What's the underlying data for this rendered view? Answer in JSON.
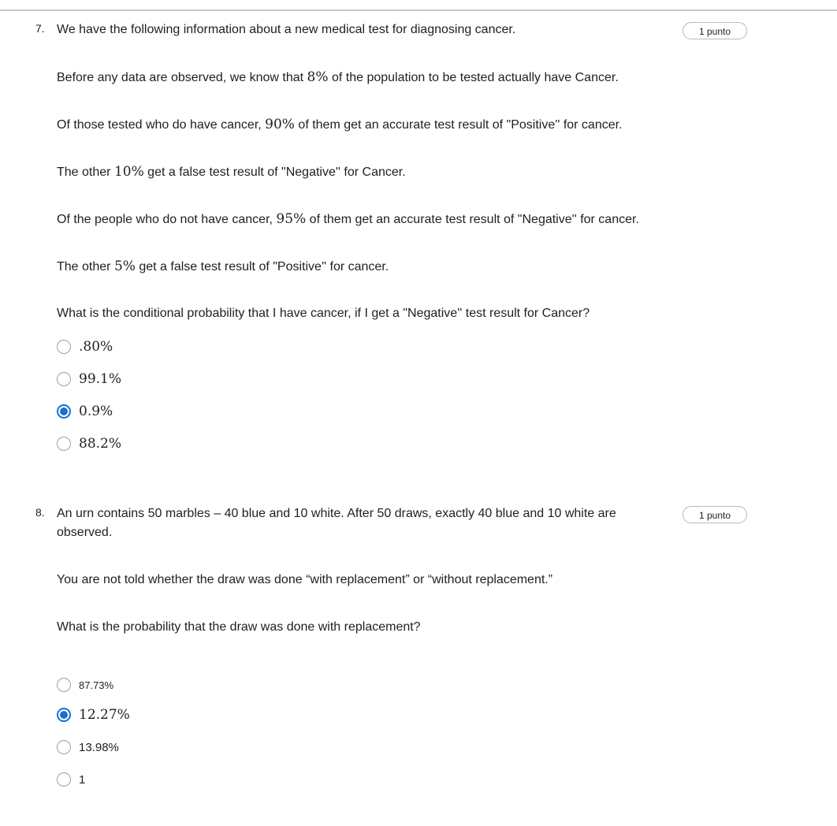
{
  "questions": [
    {
      "number": "7.",
      "points": "1 punto",
      "paragraphs": [
        {
          "pre": "We have the following information about a new medical test for diagnosing cancer.",
          "math": "",
          "post": ""
        },
        {
          "pre": "Before any data are observed, we know that ",
          "math": "8%",
          "post": " of the population to be tested actually have Cancer."
        },
        {
          "pre": "Of those tested who do have cancer, ",
          "math": "90%",
          "post": " of them get an accurate test result of \"Positive'' for cancer."
        },
        {
          "pre": "The other ",
          "math": "10%",
          "post": " get a false test result of \"Negative'' for Cancer."
        },
        {
          "pre": "Of the people who do not have cancer, ",
          "math": "95%",
          "post": " of them get an accurate test result of \"Negative'' for cancer."
        },
        {
          "pre": "The other ",
          "math": "5%",
          "post": " get a false test result of \"Positive'' for cancer."
        },
        {
          "pre": "What is the conditional probability that I have cancer, if I get a \"Negative'' test result for Cancer?",
          "math": "",
          "post": ""
        }
      ],
      "options": [
        {
          "label": ".80%",
          "selected": false
        },
        {
          "label": "99.1%",
          "selected": false
        },
        {
          "label": "0.9%",
          "selected": true
        },
        {
          "label": "88.2%",
          "selected": false
        }
      ]
    },
    {
      "number": "8.",
      "points": "1 punto",
      "paragraphs": [
        {
          "pre": "An urn contains 50 marbles – 40 blue and 10 white. After 50 draws, exactly 40 blue and 10 white are observed.",
          "math": "",
          "post": ""
        },
        {
          "pre": "You are not told whether the draw was done “with replacement” or “without replacement.”",
          "math": "",
          "post": ""
        },
        {
          "pre": "What is the probability that the draw was done with replacement?",
          "math": "",
          "post": ""
        }
      ],
      "options": [
        {
          "label": "87.73%",
          "selected": false
        },
        {
          "label": "12.27%",
          "selected": true
        },
        {
          "label": "13.98%",
          "selected": false
        },
        {
          "label": "1",
          "selected": false
        }
      ]
    }
  ],
  "colors": {
    "accent": "#1b6fd1",
    "text": "#1f1f1f",
    "radio_border": "#9e9e9e",
    "badge_border": "#b9b9b9",
    "rule": "#c8c8c8"
  }
}
